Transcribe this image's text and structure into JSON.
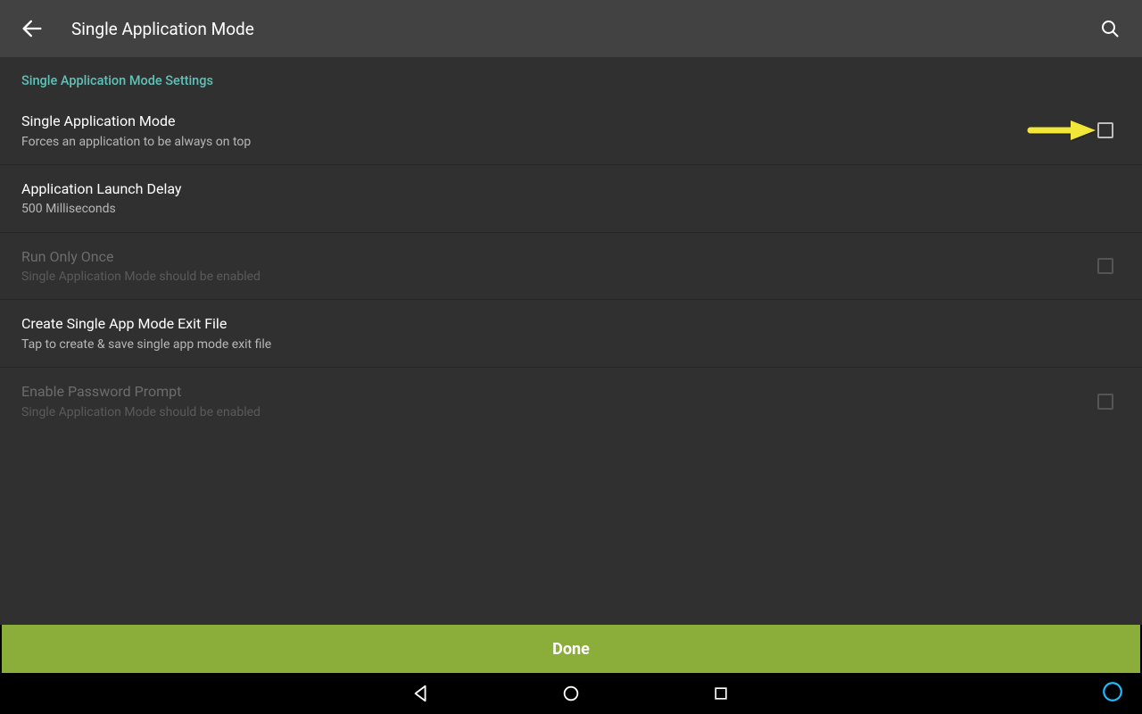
{
  "appbar": {
    "title": "Single Application Mode"
  },
  "section": {
    "header": "Single Application Mode Settings"
  },
  "settings": [
    {
      "title": "Single Application Mode",
      "subtitle": "Forces an application to be always on top",
      "checkbox": true,
      "disabled": false
    },
    {
      "title": "Application Launch Delay",
      "subtitle": "500 Milliseconds",
      "checkbox": false,
      "disabled": false
    },
    {
      "title": "Run Only Once",
      "subtitle": "Single Application Mode should be enabled",
      "checkbox": true,
      "disabled": true
    },
    {
      "title": "Create Single App Mode Exit File",
      "subtitle": "Tap to create & save single app mode exit file",
      "checkbox": false,
      "disabled": false
    },
    {
      "title": "Enable Password Prompt",
      "subtitle": "Single Application Mode should be enabled",
      "checkbox": true,
      "disabled": true
    }
  ],
  "done": {
    "label": "Done"
  }
}
